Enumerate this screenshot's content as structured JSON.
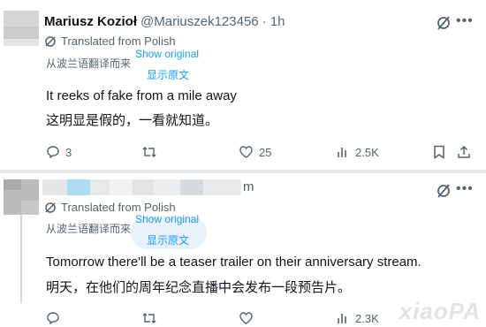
{
  "posts": [
    {
      "author": "Mariusz Kozioł",
      "handle": "@Mariuszek123456",
      "time": "· 1h",
      "translated_from": "Translated from Polish",
      "translated_zh": "从波兰语翻译而来",
      "show_original": "Show original",
      "show_original_zh": "显示原文",
      "text_en": "It reeks of fake from a mile away",
      "text_zh": "这明显是假的，一看就知道。",
      "replies": "3",
      "reposts": "",
      "likes": "25",
      "views": "2.5K"
    },
    {
      "author_suffix": "m",
      "translated_from": "Translated from Polish",
      "translated_zh": "从波兰语翻译而来",
      "show_original": "Show original",
      "show_original_zh": "显示原文",
      "text_en": "Tomorrow there'll be a teaser trailer on their anniversary stream.",
      "text_zh": "明天，在他们的周年纪念直播中会发布一段预告片。",
      "replies": "",
      "reposts": "",
      "likes": "",
      "views": "2.3K"
    }
  ],
  "icons": {
    "grok": "grok-icon",
    "more": "more-icon",
    "reply": "reply-icon",
    "repost": "repost-icon",
    "like": "like-icon",
    "views": "views-icon",
    "bookmark": "bookmark-icon",
    "share": "share-icon",
    "translate": "translate-icon"
  },
  "colors": {
    "accent": "#1d9bf0",
    "muted": "#536471",
    "text": "#0f1419"
  },
  "watermark": "xiaoPA"
}
